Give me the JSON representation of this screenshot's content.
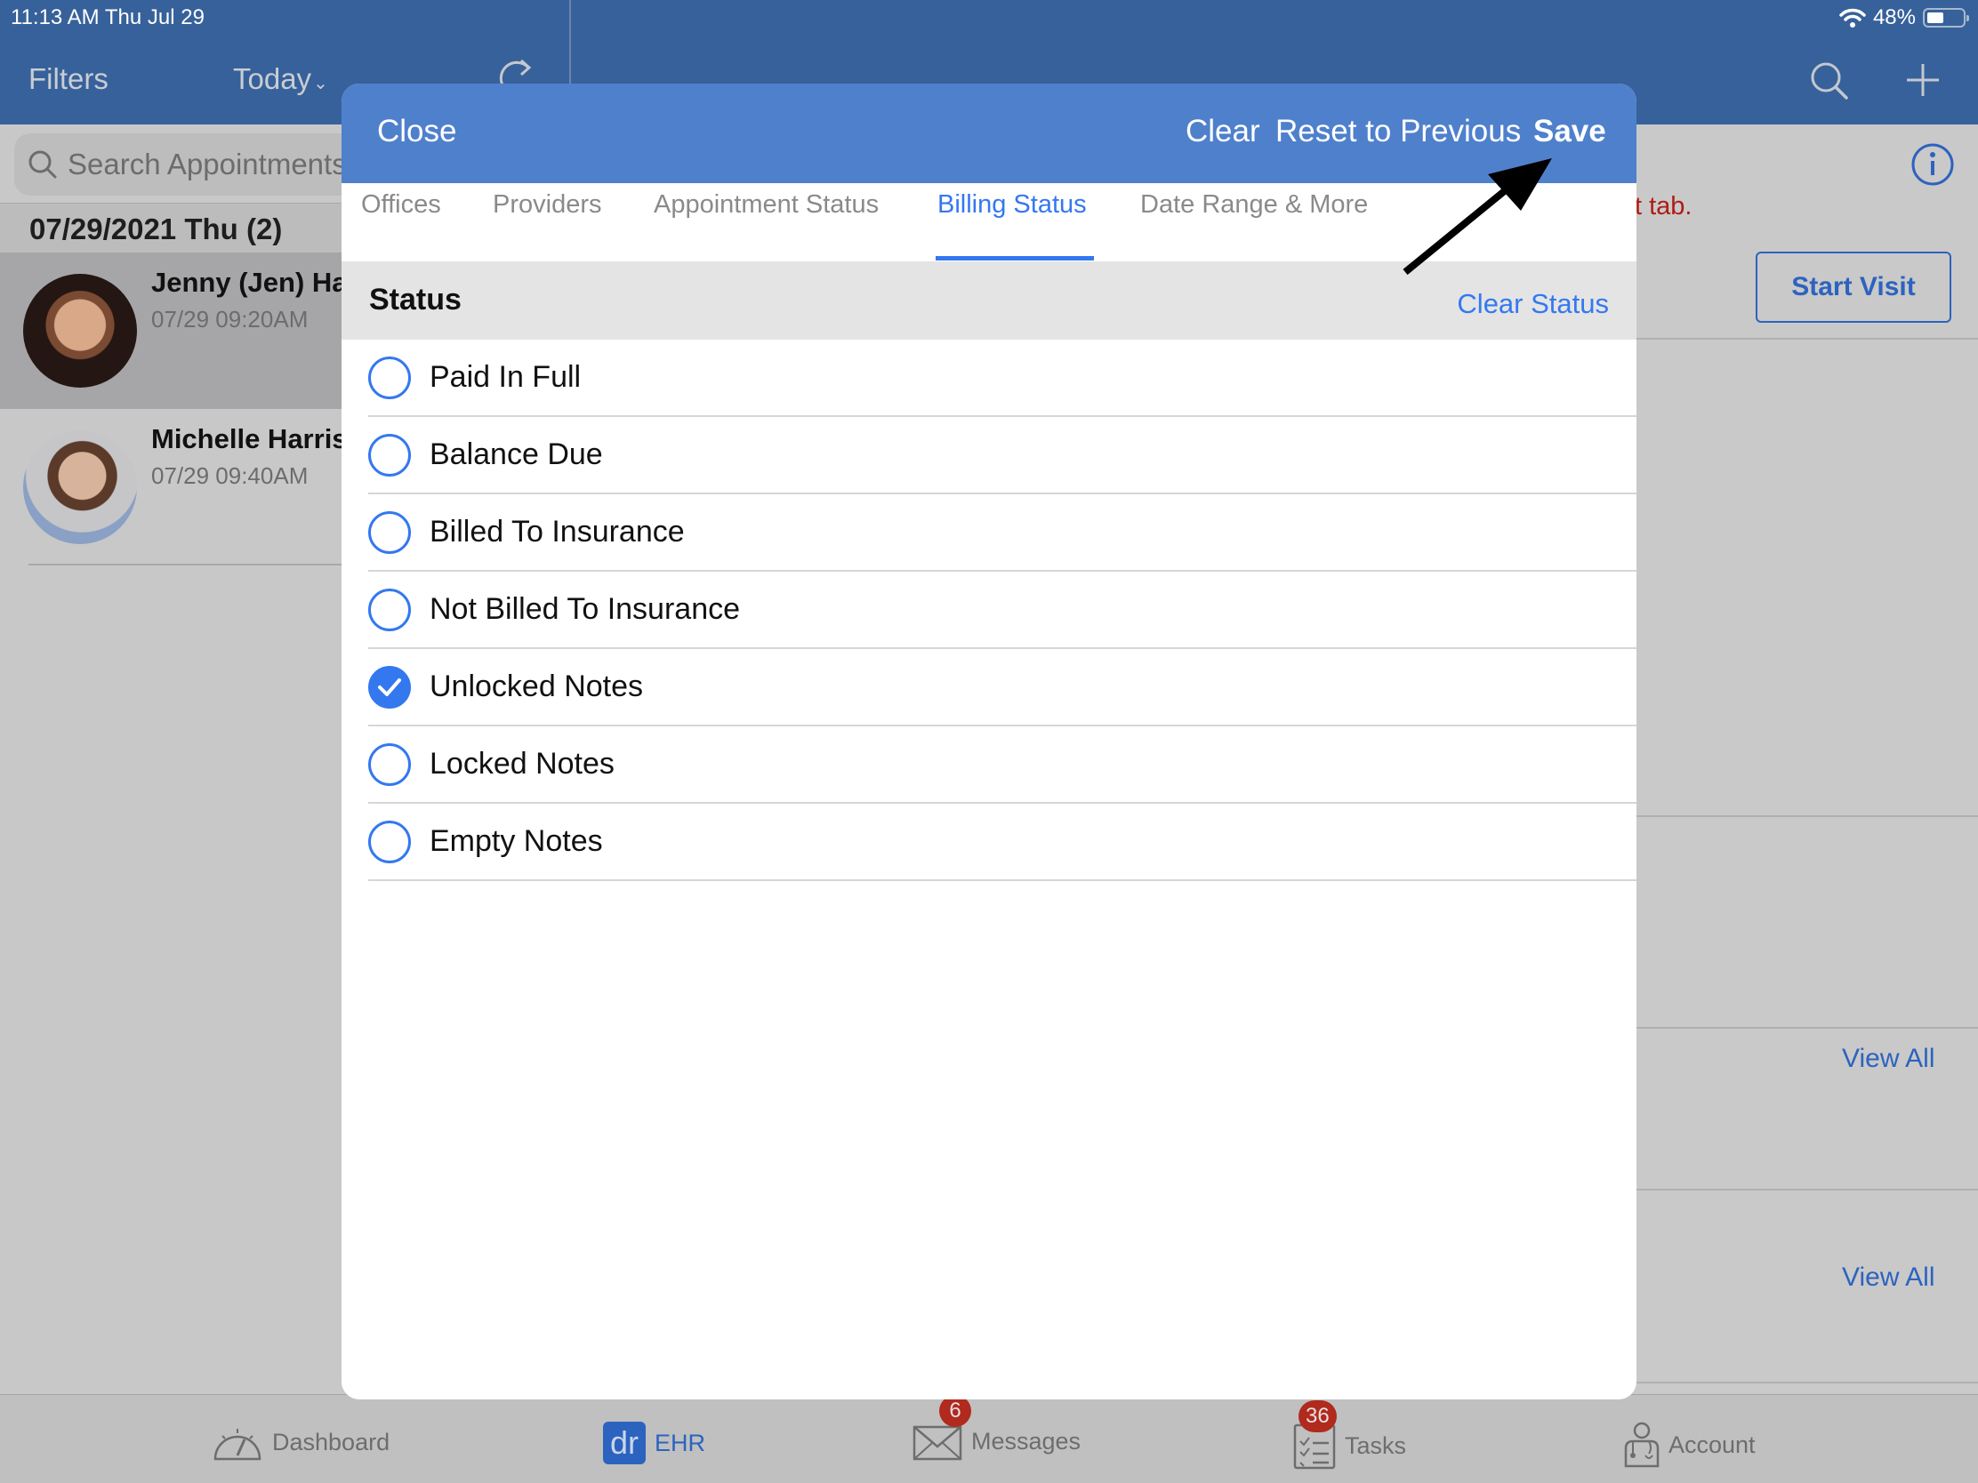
{
  "status_bar": {
    "time_date": "11:13 AM   Thu Jul 29",
    "battery_percent": "48%",
    "battery_level": 0.48
  },
  "nav": {
    "filters_label": "Filters",
    "today_label": "Today",
    "today_chevron": "⌄"
  },
  "left_pane": {
    "search_placeholder": "Search Appointments",
    "date_header": "07/29/2021 Thu (2)",
    "appointments": [
      {
        "name": "Jenny (Jen) Harris",
        "time": "07/29 09:20AM",
        "selected": true
      },
      {
        "name": "Michelle Harris",
        "time": "07/29 09:40AM",
        "selected": false
      }
    ]
  },
  "right_pane": {
    "warning_text": "t tab.",
    "start_visit_label": "Start Visit",
    "view_all_labels": [
      "View All",
      "View All"
    ],
    "colors": {
      "warning": "#b01c14",
      "link": "#2c63bf"
    }
  },
  "modal": {
    "close_label": "Close",
    "clear_label": "Clear",
    "reset_label": "Reset to Previous",
    "save_label": "Save",
    "tabs": [
      {
        "label": "Offices",
        "active": false
      },
      {
        "label": "Providers",
        "active": false
      },
      {
        "label": "Appointment Status",
        "active": false
      },
      {
        "label": "Billing Status",
        "active": true
      },
      {
        "label": "Date Range & More",
        "active": false
      }
    ],
    "section_title": "Status",
    "clear_status_label": "Clear Status",
    "options": [
      {
        "label": "Paid In Full",
        "checked": false
      },
      {
        "label": "Balance Due",
        "checked": false
      },
      {
        "label": "Billed To Insurance",
        "checked": false
      },
      {
        "label": "Not Billed To Insurance",
        "checked": false
      },
      {
        "label": "Unlocked Notes",
        "checked": true
      },
      {
        "label": "Locked Notes",
        "checked": false
      },
      {
        "label": "Empty Notes",
        "checked": false
      }
    ],
    "colors": {
      "header": "#4f80cc",
      "accent": "#3478f0"
    }
  },
  "annotation": {
    "arrow_target": "Save"
  },
  "tab_bar": {
    "items": [
      {
        "label": "Dashboard",
        "icon": "speedometer-icon",
        "active": false
      },
      {
        "label": "EHR",
        "icon": "dr-logo-icon",
        "logo_text": "dr",
        "active": true
      },
      {
        "label": "Messages",
        "icon": "envelope-icon",
        "badge": "6",
        "active": false
      },
      {
        "label": "Tasks",
        "icon": "checklist-icon",
        "badge": "36",
        "active": false
      },
      {
        "label": "Account",
        "icon": "doctor-icon",
        "active": false
      }
    ]
  }
}
